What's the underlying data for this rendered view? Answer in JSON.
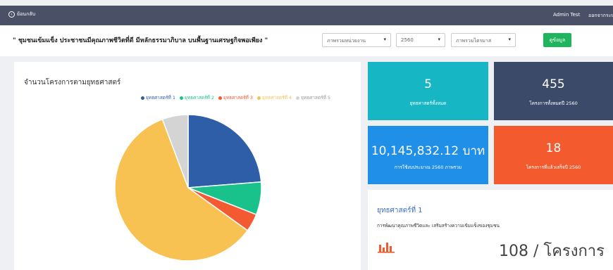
{
  "topbar": {
    "back_label": "ย้อนกลับ",
    "user_label": "Admin Test",
    "logout_label": "ออกจากระบบ"
  },
  "header": {
    "title": "\" ชุมชนเข้มแข็ง ประชาชนมีคุณภาพชีวิตที่ดี มีหลักธรรมาภิบาล บนพื้นฐานเศรษฐกิจพอเพียง \"",
    "filters": [
      {
        "value": "ภาพรวมหน่วยงาน"
      },
      {
        "value": "2560"
      },
      {
        "value": "ภาพรวมไตรมาส"
      }
    ],
    "search_label": "ดูข้อมูล"
  },
  "chart_title": "จำนวนโครงการตามยุทธศาสตร์",
  "chart_data": {
    "type": "pie",
    "categories": [
      "ยุทธศาสตร์ที่ 1",
      "ยุทธศาสตร์ที่ 2",
      "ยุทธศาสตร์ที่ 3",
      "ยุทธศาสตร์ที่ 4",
      "ยุทธศาสตร์ที่ 5"
    ],
    "values": [
      108,
      33,
      18,
      270,
      26
    ],
    "colors": [
      "#2e5ea8",
      "#19c28a",
      "#f45a32",
      "#f8c253",
      "#d4d4d4"
    ],
    "legend_position": "top-right"
  },
  "tiles": [
    {
      "value": "5",
      "label": "ยุทธศาสตร์ทั้งหมด",
      "color": "#17b6c4"
    },
    {
      "value": "455",
      "label": "โครงการทั้งหมดปี 2560",
      "color": "#3c4a69"
    },
    {
      "value": "10,145,832.12 บาท",
      "label": "การใช้งบประมาณ 2560 ภาพรวม",
      "color": "#1f8fe8"
    },
    {
      "value": "18",
      "label": "โครงการที่แล้วเสร็จปี 2560",
      "color": "#f35a2d"
    }
  ],
  "strategy": {
    "title": "ยุทธศาสตร์ที่ 1",
    "description": "การพัฒนาคุณภาพชีวิตและ เสริมสร้างความเข้มแข็งของชุมชน",
    "count": "108 / โครงการ",
    "icon": "bar-chart-icon"
  }
}
